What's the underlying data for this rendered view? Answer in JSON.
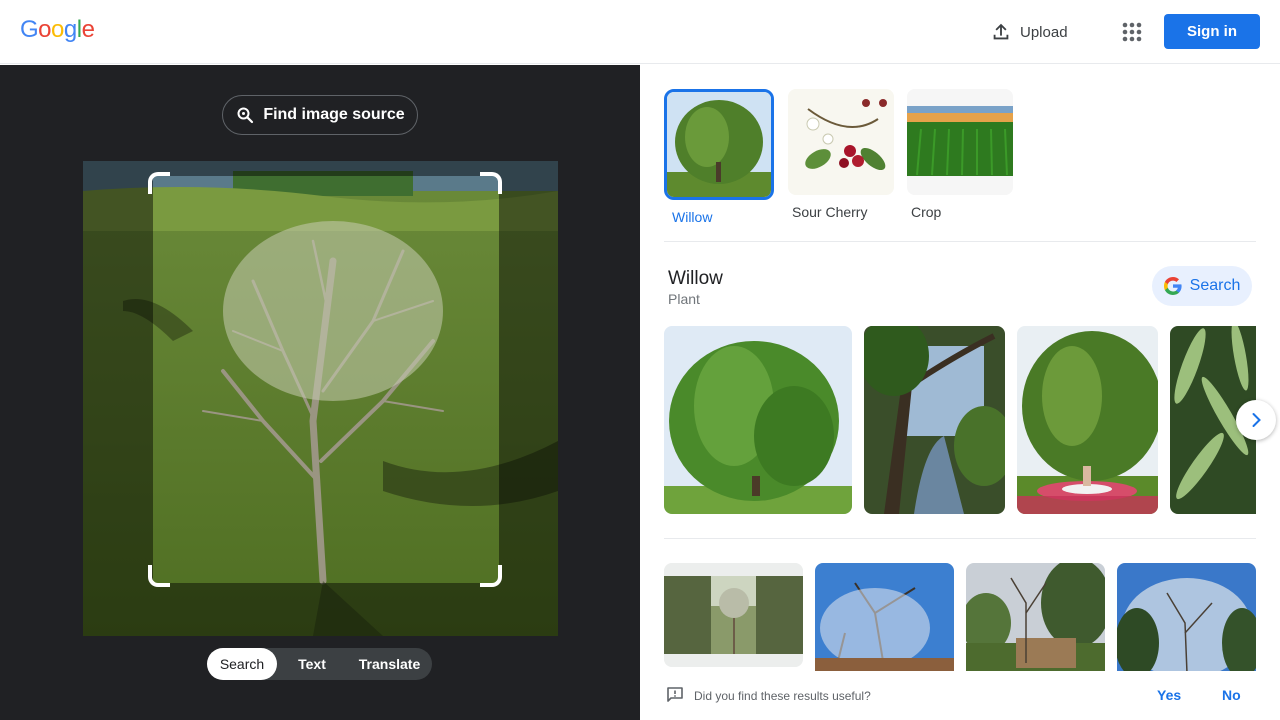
{
  "header": {
    "logo_letters": [
      {
        "ch": "G",
        "color": "#4285F4"
      },
      {
        "ch": "o",
        "color": "#EA4335"
      },
      {
        "ch": "o",
        "color": "#FBBC05"
      },
      {
        "ch": "g",
        "color": "#4285F4"
      },
      {
        "ch": "l",
        "color": "#34A853"
      },
      {
        "ch": "e",
        "color": "#EA4335"
      }
    ],
    "upload_label": "Upload",
    "apps_icon": "apps-grid-icon",
    "signin_label": "Sign in"
  },
  "lens": {
    "find_source_label": "Find image source",
    "modes": [
      {
        "label": "Search",
        "active": true
      },
      {
        "label": "Text",
        "active": false
      },
      {
        "label": "Translate",
        "active": false
      }
    ]
  },
  "results": {
    "chips": [
      {
        "label": "Willow",
        "selected": true
      },
      {
        "label": "Sour Cherry",
        "selected": false
      },
      {
        "label": "Crop",
        "selected": false
      }
    ],
    "entity": {
      "title": "Willow",
      "subtitle": "Plant",
      "search_label": "Search"
    },
    "feedback": {
      "question": "Did you find these results useful?",
      "yes": "Yes",
      "no": "No"
    }
  },
  "colors": {
    "accent": "#1a73e8",
    "dark_panel": "#202124"
  }
}
